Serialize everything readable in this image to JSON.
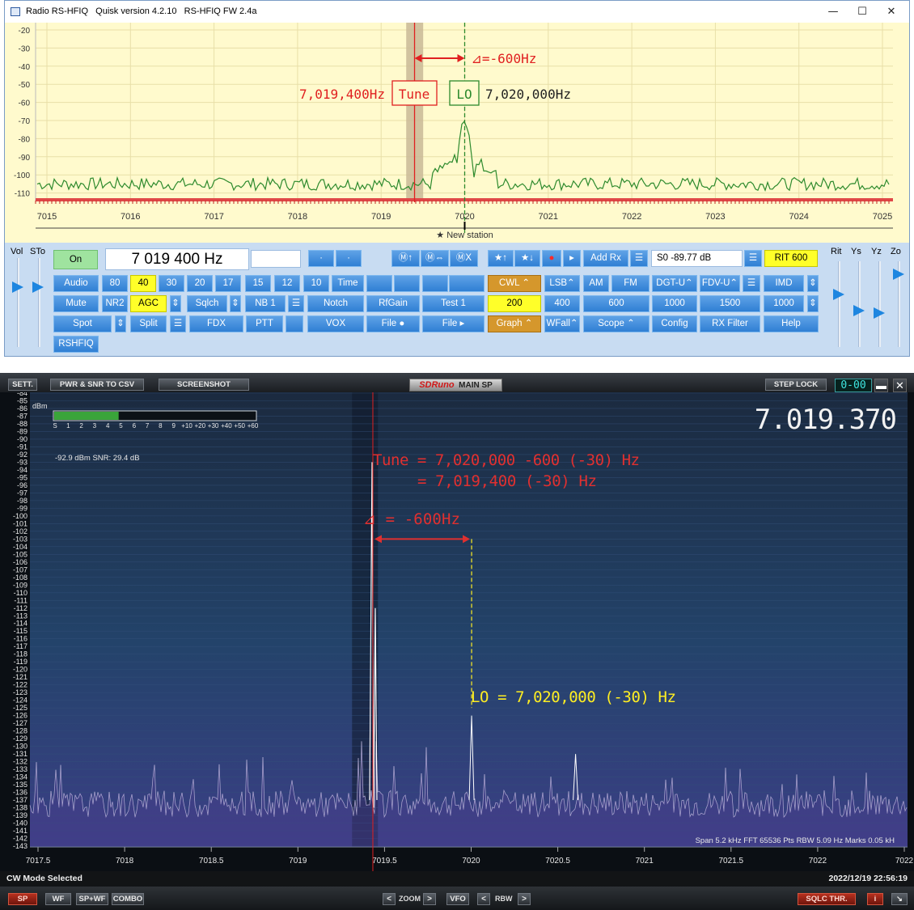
{
  "quisk": {
    "title": "Radio RS-HFIQ   Quisk version 4.2.10   RS-HFIQ FW 2.4a",
    "window_controls": {
      "minimize": "—",
      "maximize": "☐",
      "close": "✕"
    },
    "spectrum": {
      "y_labels": [
        "-20",
        "-30",
        "-40",
        "-50",
        "-60",
        "-70",
        "-80",
        "-90",
        "-100",
        "-110"
      ],
      "x_labels": [
        "7015",
        "7016",
        "7017",
        "7018",
        "7019",
        "7020",
        "7021",
        "7022",
        "7023",
        "7024",
        "7025"
      ],
      "new_station": "★ New station",
      "annotations": {
        "delta": "⊿=-600Hz",
        "tune_freq": "7,019,400Hz",
        "tune_box": "Tune",
        "lo_box": "LO",
        "lo_freq": "7,020,000Hz"
      },
      "colors": {
        "background": "#fffacd",
        "trace": "#2d8a2d",
        "tune_line": "#e02020",
        "lo_line": "#2d8a2d",
        "annotation_red": "#e02020"
      }
    },
    "controls": {
      "vol_label": "Vol",
      "sto_label": "STo",
      "rit_label": "Rit",
      "ys_label": "Ys",
      "yz_label": "Yz",
      "zo_label": "Zo",
      "on_button": "On",
      "frequency_display": "7 019 400 Hz",
      "dot1": "·",
      "dot2": "·",
      "band_buttons": [
        "Audio",
        "80",
        "40",
        "30",
        "20",
        "17",
        "15",
        "12",
        "10",
        "Time"
      ],
      "row2_buttons": [
        "Mute",
        "NR2",
        "AGC",
        "⇕",
        "Sqlch",
        "⇕",
        "NB 1",
        "☰",
        "Notch",
        "RfGain",
        "Test 1"
      ],
      "row3_buttons": [
        "Spot",
        "⇕",
        "Split",
        "☰",
        "FDX",
        "PTT",
        "VOX",
        "File ●",
        "File ▸"
      ],
      "rshfiq": "RSHFIQ",
      "mem_buttons": [
        "Ⓜ↑",
        "Ⓜ⇔",
        "ⓂX"
      ],
      "star_up": "★↑",
      "star_down": "★↓",
      "record": "●",
      "play": "▸",
      "add_rx": "Add Rx",
      "menu_icon": "☰",
      "smeter": "S0   -89.77 dB",
      "rit": "RIT 600",
      "mode_row": [
        "CWL ⌃",
        "LSB⌃",
        "AM",
        "FM",
        "DGT-U⌃",
        "FDV-U⌃",
        "☰",
        "IMD",
        "⇕"
      ],
      "filter_row": [
        "200",
        "400",
        "600",
        "1000",
        "1500",
        "1000",
        "⇕"
      ],
      "bottom_row": [
        "Graph ⌃",
        "WFall⌃",
        "Scope ⌃",
        "Config",
        "RX Filter",
        "Help"
      ]
    }
  },
  "sdruno": {
    "top_buttons": [
      "SETT.",
      "PWR & SNR TO CSV",
      "SCREENSHOT"
    ],
    "logo_brand": "SDRuno",
    "logo_mode": "MAIN SP",
    "step_lock": "STEP LOCK",
    "counter": "0-00",
    "minimize": "▬",
    "close": "✕",
    "frequency": "7.019.370",
    "dbm_label": "dBm",
    "smeter_scale": [
      "S",
      "1",
      "2",
      "3",
      "4",
      "5",
      "6",
      "7",
      "8",
      "9",
      "+10",
      "+20",
      "+30",
      "+40",
      "+50",
      "+60"
    ],
    "smeter_fill_fraction": 0.32,
    "level_readout": "-92.9 dBm    SNR: 29.4 dB",
    "y_labels": [
      "-84",
      "-85",
      "-86",
      "-87",
      "-88",
      "-89",
      "-90",
      "-91",
      "-92",
      "-93",
      "-94",
      "-95",
      "-96",
      "-97",
      "-98",
      "-99",
      "-100",
      "-101",
      "-102",
      "-103",
      "-104",
      "-105",
      "-106",
      "-107",
      "-108",
      "-109",
      "-110",
      "-111",
      "-112",
      "-113",
      "-114",
      "-115",
      "-116",
      "-117",
      "-118",
      "-119",
      "-120",
      "-121",
      "-122",
      "-123",
      "-124",
      "-125",
      "-126",
      "-127",
      "-128",
      "-129",
      "-130",
      "-131",
      "-132",
      "-133",
      "-134",
      "-135",
      "-136",
      "-137",
      "-138",
      "-139",
      "-140",
      "-141",
      "-142",
      "-143"
    ],
    "x_labels": [
      "7017.5",
      "7018",
      "7018.5",
      "7019",
      "7019.5",
      "7020",
      "7020.5",
      "7021",
      "7021.5",
      "7022",
      "7022"
    ],
    "annotations": {
      "tune_line1": "Tune = 7,020,000 -600 (-30) Hz",
      "tune_line2": "= 7,019,400 (-30) Hz",
      "delta": "⊿ = -600Hz",
      "lo": "LO = 7,020,000 (-30) Hz"
    },
    "info_line": "Span 5.2 kHz   FFT 65536 Pts   RBW 5.09 Hz   Marks 0.05 kH",
    "status_left": "CW Mode Selected",
    "status_right": "2022/12/19 22:56:19",
    "bottom_buttons": [
      "SP",
      "WF",
      "SP+WF",
      "COMBO"
    ],
    "zoom_label": "ZOOM",
    "vfo_label": "VFO",
    "rbw_label": "RBW",
    "left_arrow": "<",
    "right_arrow": ">",
    "sqlc": "SQLC THR.",
    "info_btn": "i",
    "corner_btn": "↘",
    "colors": {
      "trace": "#cfc8e8",
      "tune_marker": "#e02020",
      "annotation_red": "#e03030",
      "annotation_yellow": "#ffee22",
      "background": "#1a2f4d"
    }
  }
}
